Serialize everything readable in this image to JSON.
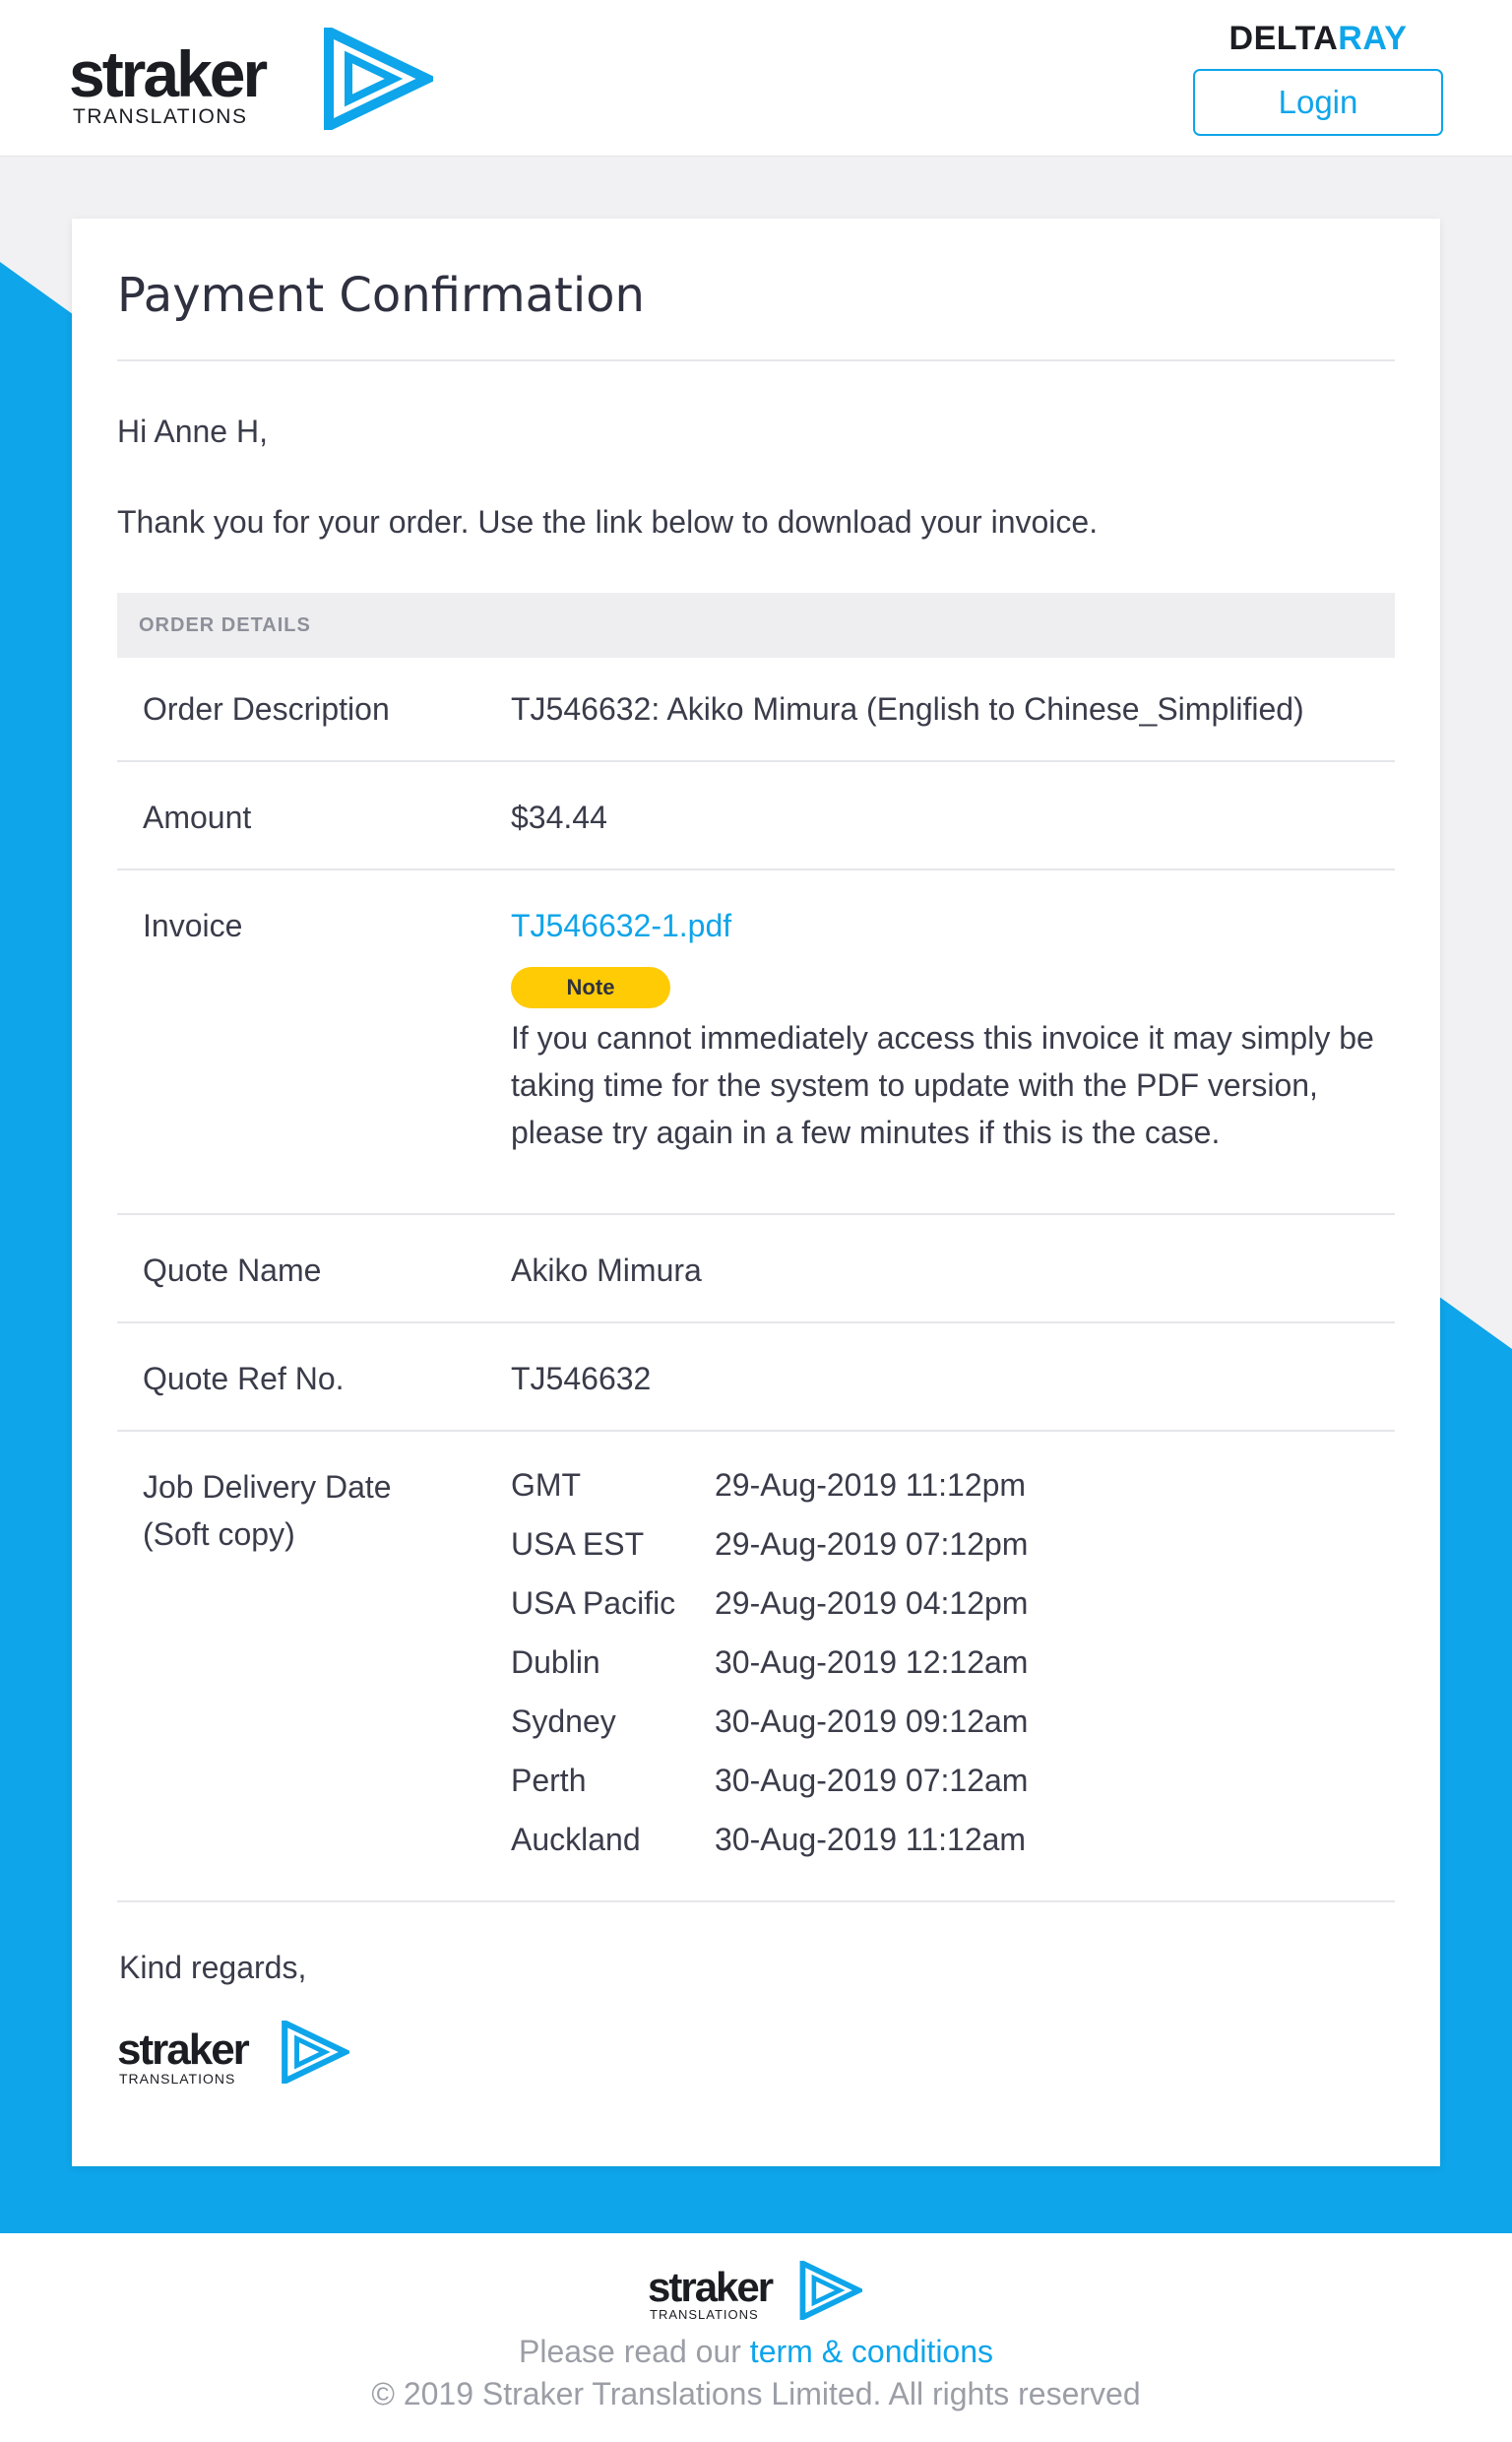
{
  "header": {
    "brand_name": "straker",
    "brand_sub": "TRANSLATIONS",
    "partner_part1": "DELTA",
    "partner_part2": "RAY",
    "login_label": "Login"
  },
  "colors": {
    "accent": "#0ea5ea",
    "note_badge": "#ffcb05",
    "page_background": "#f1f1f3",
    "text": "#3a3c4a"
  },
  "email": {
    "title": "Payment Confirmation",
    "greeting": "Hi Anne H,",
    "intro": "Thank you for your order. Use the link below to download your invoice.",
    "details_heading": "ORDER DETAILS",
    "rows": {
      "order_description": {
        "label": "Order Description",
        "value": "TJ546632: Akiko Mimura (English to Chinese_Simplified)"
      },
      "amount": {
        "label": "Amount",
        "value": "$34.44"
      },
      "invoice": {
        "label": "Invoice",
        "value": "TJ546632-1.pdf"
      },
      "quote_name": {
        "label": "Quote Name",
        "value": "Akiko Mimura"
      },
      "quote_ref": {
        "label": "Quote Ref No.",
        "value": "TJ546632"
      },
      "delivery": {
        "label_line1": "Job Delivery Date",
        "label_line2": "(Soft copy)"
      }
    },
    "note_badge": "Note",
    "note_text": "If you cannot immediately access this invoice it may simply be taking time for the system to update with the PDF version, please try again in a few minutes if this is the case.",
    "delivery_times": [
      {
        "zone": "GMT",
        "time": "29-Aug-2019 11:12pm"
      },
      {
        "zone": "USA EST",
        "time": "29-Aug-2019 07:12pm"
      },
      {
        "zone": "USA Pacific",
        "time": "29-Aug-2019 04:12pm"
      },
      {
        "zone": "Dublin",
        "time": "30-Aug-2019 12:12am"
      },
      {
        "zone": "Sydney",
        "time": "30-Aug-2019 09:12am"
      },
      {
        "zone": "Perth",
        "time": "30-Aug-2019 07:12am"
      },
      {
        "zone": "Auckland",
        "time": "30-Aug-2019 11:12am"
      }
    ],
    "regards": "Kind regards,"
  },
  "footer": {
    "read_prefix": "Please read our ",
    "terms_link": "term & conditions",
    "copyright": "© 2019 Straker Translations Limited. All rights reserved"
  }
}
